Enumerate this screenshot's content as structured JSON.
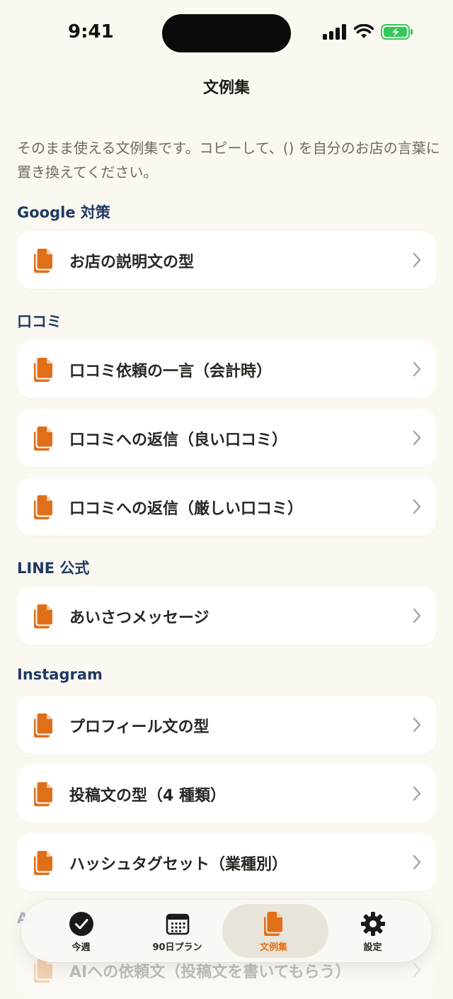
{
  "status_bar": {
    "time": "9:41"
  },
  "nav": {
    "title": "文例集"
  },
  "intro": "そのまま使える文例集です。コピーして、() を自分のお店の言葉に置き換えてください。",
  "sections": [
    {
      "title": "Google 対策",
      "items": [
        {
          "label": "お店の説明文の型"
        }
      ]
    },
    {
      "title": "口コミ",
      "items": [
        {
          "label": "口コミ依頼の一言（会計時）"
        },
        {
          "label": "口コミへの返信（良い口コミ）"
        },
        {
          "label": "口コミへの返信（厳しい口コミ）"
        }
      ]
    },
    {
      "title": "LINE 公式",
      "items": [
        {
          "label": "あいさつメッセージ"
        }
      ]
    },
    {
      "title": "Instagram",
      "items": [
        {
          "label": "プロフィール文の型"
        },
        {
          "label": "投稿文の型（4 種類）"
        },
        {
          "label": "ハッシュタグセット（業種別）"
        }
      ]
    }
  ],
  "behind_tabbar": {
    "section_title": "AI",
    "item_label": "AIへの依頼文（投稿文を書いてもらう）"
  },
  "tabbar": {
    "tabs": [
      {
        "label": "今週",
        "icon": "checkmark-circle-icon"
      },
      {
        "label": "90日プラン",
        "icon": "calendar-icon"
      },
      {
        "label": "文例集",
        "icon": "documents-icon",
        "active": true
      },
      {
        "label": "設定",
        "icon": "gear-icon"
      }
    ]
  },
  "colors": {
    "accent": "#E06F1A",
    "section_heading": "#1F3A64",
    "background": "#FBF8F1",
    "card": "#FFFFFF"
  }
}
